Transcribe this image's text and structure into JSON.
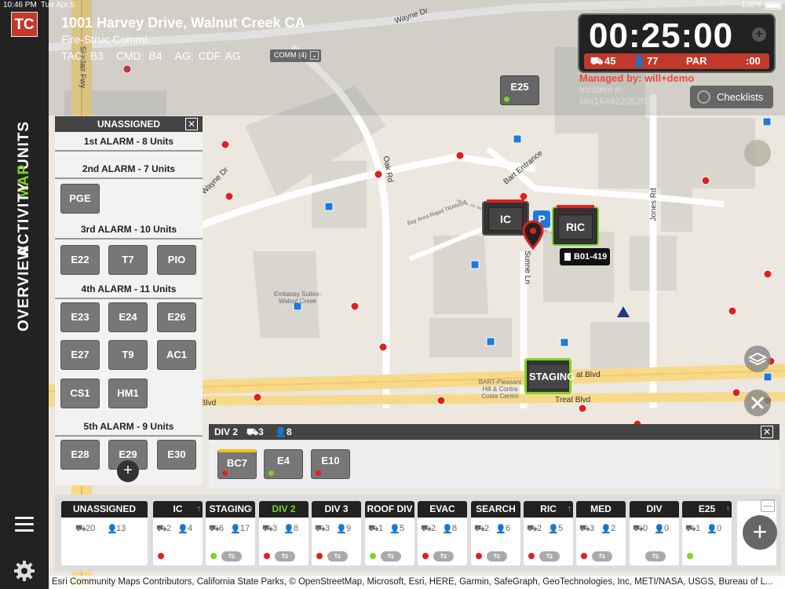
{
  "status": {
    "time": "10:46 PM",
    "date": "Tue Apr 5",
    "battery": "100%"
  },
  "nav": {
    "logo": "TC",
    "units": "UNITS",
    "map": "MAP",
    "activity": "ACTIVITY",
    "overview": "OVERVIEW"
  },
  "incident": {
    "address": "1001 Harvey Drive, Walnut Creek CA",
    "type": "Fire-Struc Comml",
    "tac": "TAC: B3",
    "cmd": "CMD: B4",
    "ag": "AG: CDF AG",
    "comm": "COMM (4)",
    "timer": "00:25:00",
    "units_count": "45",
    "personnel_count": "77",
    "par_label": "PAR",
    "par_time": ":00",
    "managed_by": "Managed by: will+demo",
    "incident_label": "Incident #:",
    "incident_number": "sim1649222520",
    "checklists": "Checklists"
  },
  "map": {
    "streets": {
      "wayne_dr_top": "Wayne Dr",
      "wayne_dr_left": "Wayne Dr",
      "oak_rd": "Oak Rd",
      "bart_entrance": "Bart Entrance",
      "sunne_ln": "Sunne Ln",
      "jones_rd": "Jones Rd",
      "treat_blvd_left": "Treat Blvd",
      "treat_blvd_right": "Treat Blvd",
      "treat_blvd_mid": "at Blvd",
      "sinclair_fwy": "Sinclair Fwy",
      "bart_transit": "Bay Area Rapid TRANSIT"
    },
    "places": {
      "embassy": "Embassy Suites-Walnut Creek",
      "bart_station": "BART-Pleasant Hill & Contra Costa Centre"
    },
    "markers": {
      "e25": "E25",
      "ic": "IC",
      "ric": "RIC",
      "staging": "STAGING",
      "b01": "B01-419"
    }
  },
  "unassigned": {
    "title": "UNASSIGNED",
    "alarms": [
      {
        "title": "1st ALARM - 8 Units",
        "units": []
      },
      {
        "title": "2nd ALARM - 7 Units",
        "units": [
          "PGE"
        ]
      },
      {
        "title": "3rd ALARM - 10 Units",
        "units": [
          "E22",
          "T7",
          "PIO"
        ]
      },
      {
        "title": "4th ALARM - 11 Units",
        "units": [
          "E23",
          "E24",
          "E26",
          "E27",
          "T9",
          "AC1",
          "CS1",
          "HM1"
        ]
      },
      {
        "title": "5th ALARM - 9 Units",
        "units": [
          "E28",
          "E29",
          "E30"
        ]
      }
    ]
  },
  "div2": {
    "title": "DIV 2",
    "units_count": "3",
    "personnel_count": "8",
    "units": [
      {
        "label": "BC7",
        "status_color": "#e02020"
      },
      {
        "label": "E4",
        "status_color": "#7ed321"
      },
      {
        "label": "E10",
        "status_color": "#e02020"
      }
    ]
  },
  "groups": [
    {
      "label": "UNASSIGNED",
      "units": "20",
      "people": "13",
      "status_color": "",
      "accountability": false,
      "swap": false,
      "arrow": false,
      "active": false
    },
    {
      "label": "IC",
      "units": "2",
      "people": "4",
      "status_color": "#e02020",
      "arrow": true,
      "swap": false,
      "active": false
    },
    {
      "label": "STAGING",
      "units": "6",
      "people": "17",
      "status_color": "#7ed321",
      "arrow": true,
      "swap": true,
      "active": false
    },
    {
      "label": "DIV 2",
      "units": "3",
      "people": "8",
      "status_color": "#e02020",
      "arrow": false,
      "swap": true,
      "active": true
    },
    {
      "label": "DIV 3",
      "units": "3",
      "people": "9",
      "status_color": "#e02020",
      "arrow": false,
      "swap": true,
      "active": false
    },
    {
      "label": "ROOF DIV",
      "units": "1",
      "people": "5",
      "status_color": "#7ed321",
      "arrow": false,
      "swap": true,
      "active": false
    },
    {
      "label": "EVAC",
      "units": "2",
      "people": "8",
      "status_color": "#e02020",
      "arrow": false,
      "swap": true,
      "active": false
    },
    {
      "label": "SEARCH",
      "units": "2",
      "people": "6",
      "status_color": "#e02020",
      "arrow": false,
      "swap": true,
      "active": false
    },
    {
      "label": "RIC",
      "units": "2",
      "people": "5",
      "status_color": "#e02020",
      "arrow": true,
      "swap": true,
      "active": false
    },
    {
      "label": "MED",
      "units": "3",
      "people": "2",
      "status_color": "#e02020",
      "arrow": false,
      "swap": true,
      "active": false
    },
    {
      "label": "DIV",
      "units": "0",
      "people": "0",
      "status_color": "",
      "arrow": false,
      "swap": true,
      "active": false
    },
    {
      "label": "E25",
      "units": "1",
      "people": "0",
      "status_color": "#7ed321",
      "arrow": true,
      "swap": false,
      "active": false
    }
  ],
  "attribution": "Esri Community Maps Contributors, California State Parks, © OpenStreetMap, Microsoft, Esri, HERE, Garmin, SafeGraph, GeoTechnologies, Inc, METI/NASA, USGS, Bureau of L..."
}
